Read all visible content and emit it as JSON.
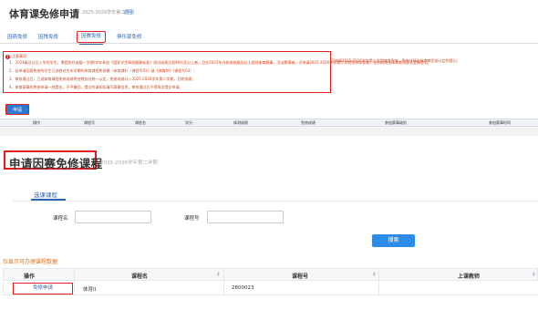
{
  "header": {
    "title": "体育课免修申请",
    "term": "2025-2026学年第二学期",
    "link": "返回"
  },
  "tabs": [
    {
      "label": "因病免修"
    },
    {
      "label": "因残免修"
    },
    {
      "label": "因赛免修",
      "active": true
    },
    {
      "label": "俱乐部免修"
    }
  ],
  "notice": {
    "head": "注意事项:",
    "lines": [
      "1、2024级及以后入学的学生，需提前在省级一学期/学年参加《国家学生体质健康标准》测试成绩达到80分及以上者，且在2025年内参加校级及以上组别体育赛事，活动期满者。可申请2025-2026学年第二学期免修体育课，免修成绩由体育教学部认定和登记;",
      "2、若申请因赛免修的学生已选修对应本学期的体育课程免修模（体育课Ⅱ）（课程号01）或《体育Ⅳ》（课程号03）;",
      "3、审核通过后，已选体育课程免修成绩将由教务处统一认定，免修成绩计入2025-2026学年第二学期，且转成绩;",
      "4、体育赛事的免修申请一经提出，不予撤回，提交时请如实填写赛事信息，审核通过后不得再次提交申请。"
    ],
    "overflow": "可申请2025-2026学年第二学期体育免修，免修成绩由体育教学部认定和登记;"
  },
  "apply_button": "申请",
  "top_table": {
    "columns": [
      "操作",
      "课程号",
      "课程名",
      "学分",
      "体测成绩",
      "免修成绩",
      "参加赛事级别",
      "参加赛事时间"
    ]
  },
  "apply_panel": {
    "title": "申请因赛免修课程",
    "term": "2025-2026学年第二学期",
    "tab": "选课课程",
    "form": {
      "course_name_label": "课程名",
      "course_name_value": "",
      "course_no_label": "课程号",
      "course_no_value": ""
    },
    "search_button": "搜索",
    "tip": "仅显示可办理课程数据",
    "table": {
      "columns": [
        "操作",
        "课程名",
        "课程号",
        "上课教师"
      ],
      "rows": [
        {
          "action": "免修申请",
          "course_name": "体育II",
          "course_no": "2800023",
          "teacher": ""
        }
      ]
    }
  },
  "colors": {
    "accent": "#2d7ad6",
    "highlight": "#e02020",
    "notice_text": "#d9421a",
    "tip_text": "#e07020"
  }
}
